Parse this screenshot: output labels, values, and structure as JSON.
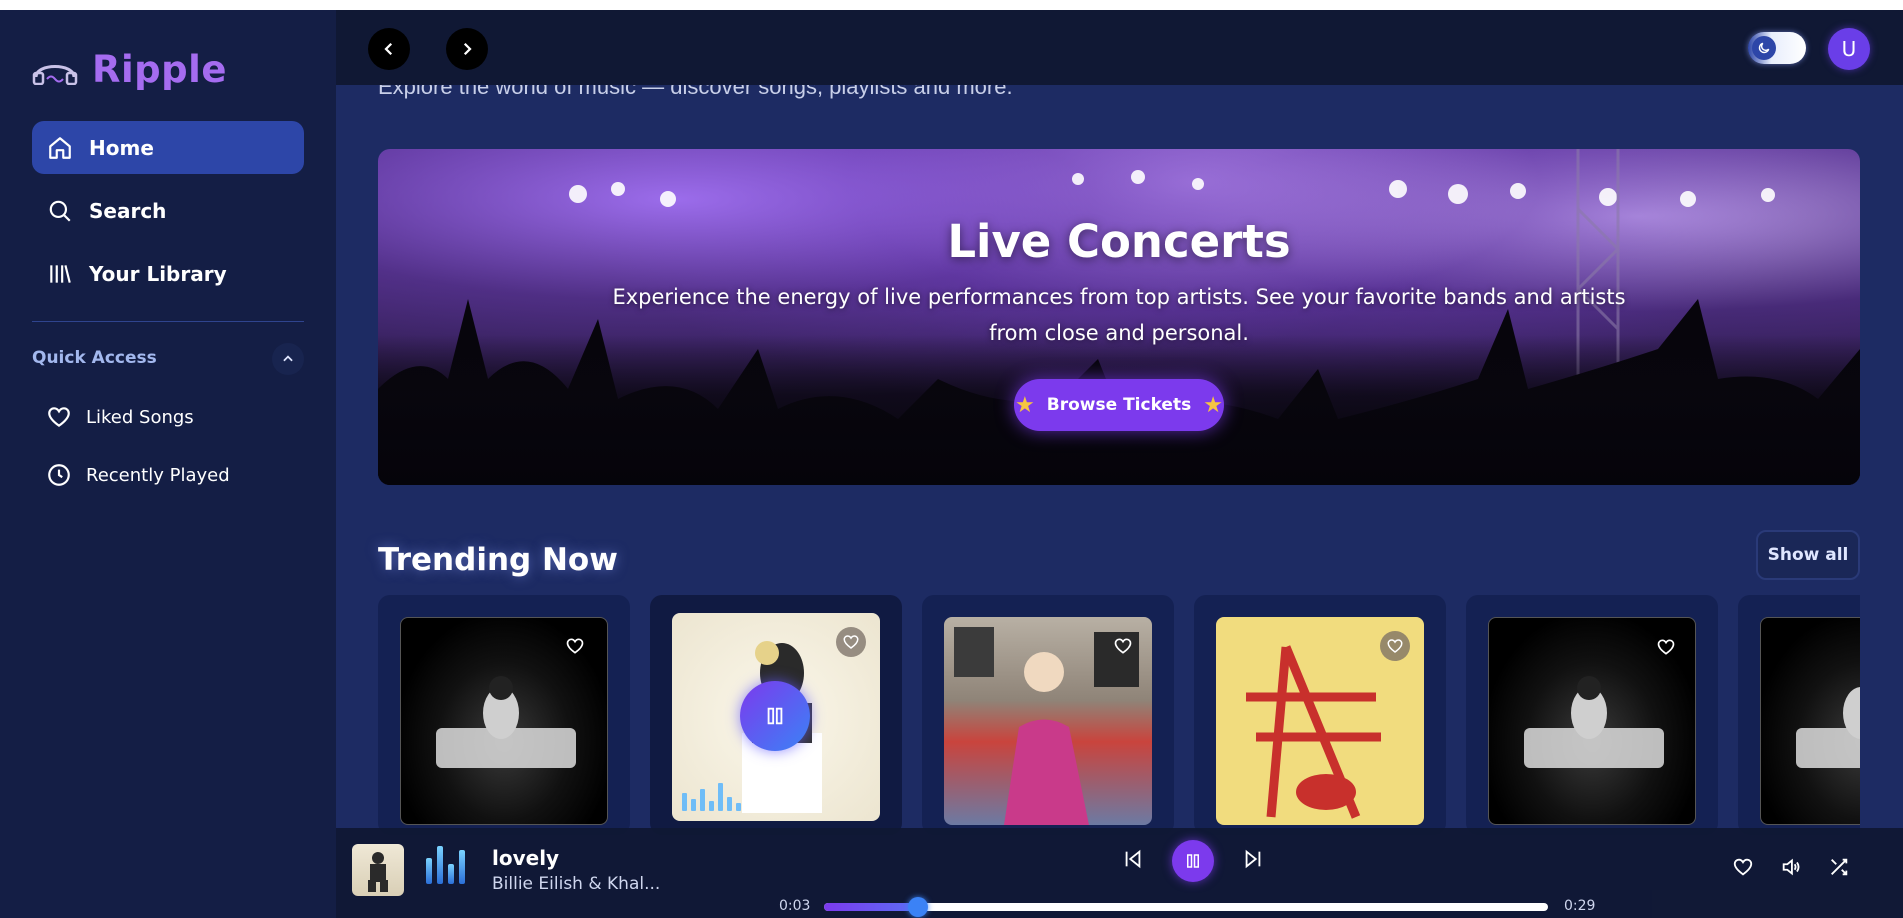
{
  "brand": {
    "name": "Ripple"
  },
  "nav": [
    {
      "label": "Home",
      "icon": "home-icon",
      "active": true
    },
    {
      "label": "Search",
      "icon": "search-icon",
      "active": false
    },
    {
      "label": "Your Library",
      "icon": "library-icon",
      "active": false
    }
  ],
  "quick_access": {
    "title": "Quick Access",
    "items": [
      {
        "label": "Liked Songs",
        "icon": "heart-icon"
      },
      {
        "label": "Recently Played",
        "icon": "clock-icon"
      }
    ]
  },
  "topbar": {
    "avatar_initial": "U"
  },
  "main": {
    "subtitle": "Explore the world of music — discover songs, playlists and more."
  },
  "banner": {
    "title": "Live Concerts",
    "text": "Experience the energy of live performances from top artists. See your favorite bands and artists from close and personal.",
    "button_label": "Browse Tickets"
  },
  "trending": {
    "title": "Trending Now",
    "show_all_label": "Show all"
  },
  "player": {
    "title": "lovely",
    "artist": "Billie Eilish & Khal...",
    "current_time": "0:03",
    "total_time": "0:29",
    "progress": 0.13
  },
  "colors": {
    "accent": "#7c3aed",
    "brand": "#a56cf0",
    "active_nav": "#2d46a8",
    "background": "#1d2b63"
  }
}
